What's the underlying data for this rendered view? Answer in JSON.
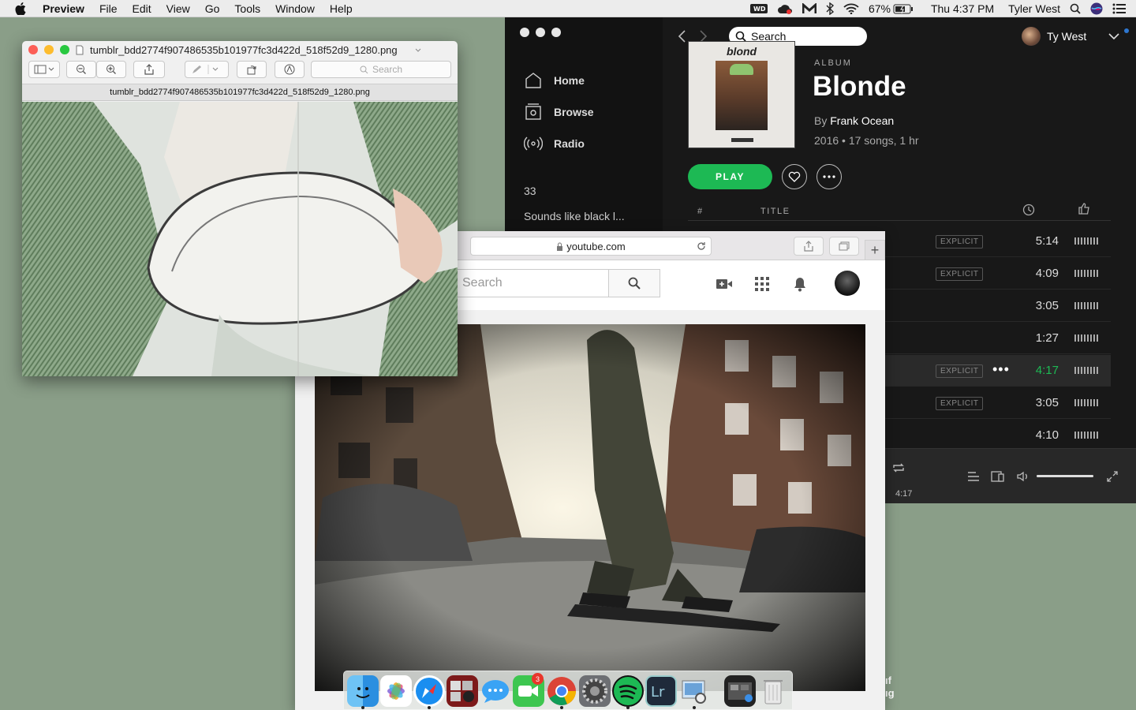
{
  "menubar": {
    "app": "Preview",
    "items": [
      "File",
      "Edit",
      "View",
      "Go",
      "Tools",
      "Window",
      "Help"
    ],
    "battery": "67%",
    "clock": "Thu 4:37 PM",
    "user": "Tyler West"
  },
  "preview": {
    "filename": "tumblr_bdd2774f907486535b101977fc3d422d_518f52d9_1280.png",
    "search_placeholder": "Search",
    "subtitle": "tumblr_bdd2774f907486535b101977fc3d422d_518f52d9_1280.png"
  },
  "spotify": {
    "nav": [
      "Home",
      "Browse",
      "Radio"
    ],
    "count": "33",
    "playlist": "Sounds like black l...",
    "search_placeholder": "Search",
    "user": "Ty West",
    "album_label": "ALBUM",
    "album_title": "Blonde",
    "by_prefix": "By",
    "artist": "Frank Ocean",
    "meta": "2016 • 17 songs, 1 hr",
    "play": "PLAY",
    "col_num": "#",
    "col_title": "TITLE",
    "cover_title": "blond",
    "explicit_label": "EXPLICIT",
    "tracks": [
      {
        "duration": "5:14",
        "explicit": true
      },
      {
        "duration": "4:09",
        "explicit": true
      },
      {
        "duration": "3:05",
        "explicit": false
      },
      {
        "duration": "1:27",
        "explicit": false
      },
      {
        "duration": "4:17",
        "explicit": true
      },
      {
        "duration": "3:05",
        "explicit": true
      },
      {
        "duration": "4:10",
        "explicit": false
      }
    ],
    "player_time": "4:17",
    "volume": 1.0
  },
  "safari": {
    "url": "youtube.com",
    "yt_search_placeholder": "Search"
  },
  "desktop": {
    "partial_lines": [
      "ıf",
      "ıg"
    ]
  },
  "dock": {
    "apps": [
      "Finder",
      "Photos",
      "Safari",
      "Photo Booth",
      "Messages",
      "FaceTime",
      "Chrome",
      "System Preferences",
      "Spotify",
      "Lightroom",
      "Preview",
      "Screenshot",
      "Trash"
    ],
    "facetime_badge": "3"
  },
  "colors": {
    "spotify_green": "#1db954",
    "desktop": "#8a9e88"
  }
}
